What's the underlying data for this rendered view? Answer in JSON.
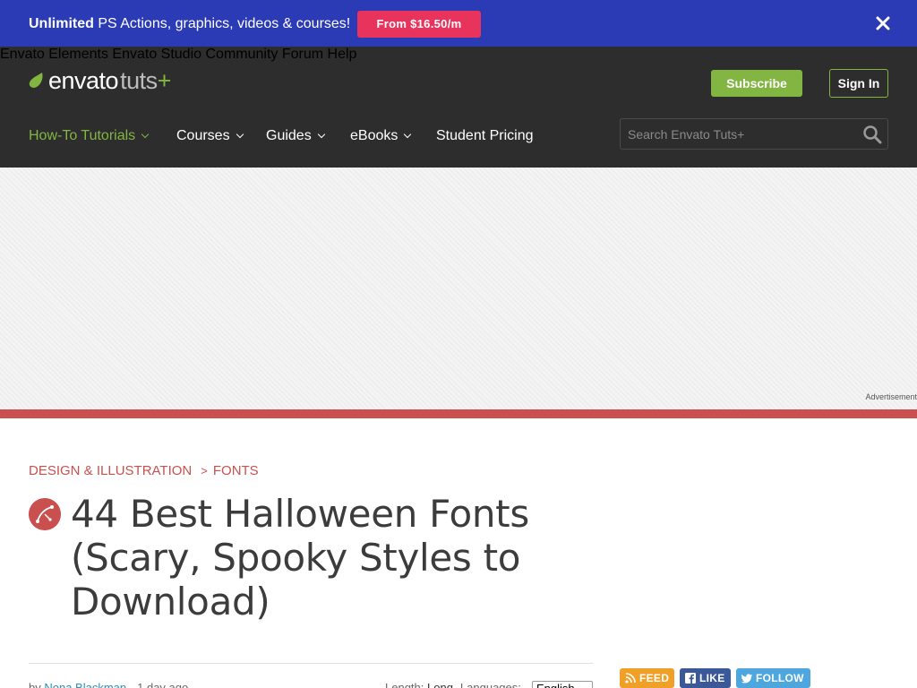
{
  "promo": {
    "bold": "Unlimited",
    "text": " PS Actions, graphics, videos & courses!",
    "button": "From $16.50/m"
  },
  "logo": {
    "brand": "envato",
    "product": "tuts",
    "plus": "+"
  },
  "topnav": {
    "items": [
      "Envato Elements",
      "Envato Studio",
      "Community",
      "Forum",
      "Help"
    ],
    "subscribe": "Subscribe",
    "signin": "Sign In"
  },
  "mainnav": {
    "items": [
      "How-To Tutorials",
      "Courses",
      "Guides",
      "eBooks",
      "Student Pricing"
    ]
  },
  "search": {
    "placeholder": "Search Envato Tuts+"
  },
  "ad": {
    "label": "Advertisement"
  },
  "article": {
    "breadcrumb": [
      "DESIGN & ILLUSTRATION",
      "FONTS"
    ],
    "breadcrumb_sep": ">",
    "title": "44 Best Halloween Fonts (Scary, Spooky Styles to Download)",
    "byline_prefix": "by ",
    "author": "Nona Blackman",
    "time": "1 day ago",
    "length_label": "Length: ",
    "length_value": "Long",
    "language_label": "Languages: ",
    "language_value": "English"
  },
  "social": {
    "feed": "FEED",
    "like": "LIKE",
    "follow": "FOLLOW"
  },
  "colors": {
    "promo_bg": "#2b3bb6",
    "promo_btn": "#e8335c",
    "header_bg": "#2d2d2d",
    "accent_green": "#82b541",
    "accent_red": "#c9504f"
  }
}
